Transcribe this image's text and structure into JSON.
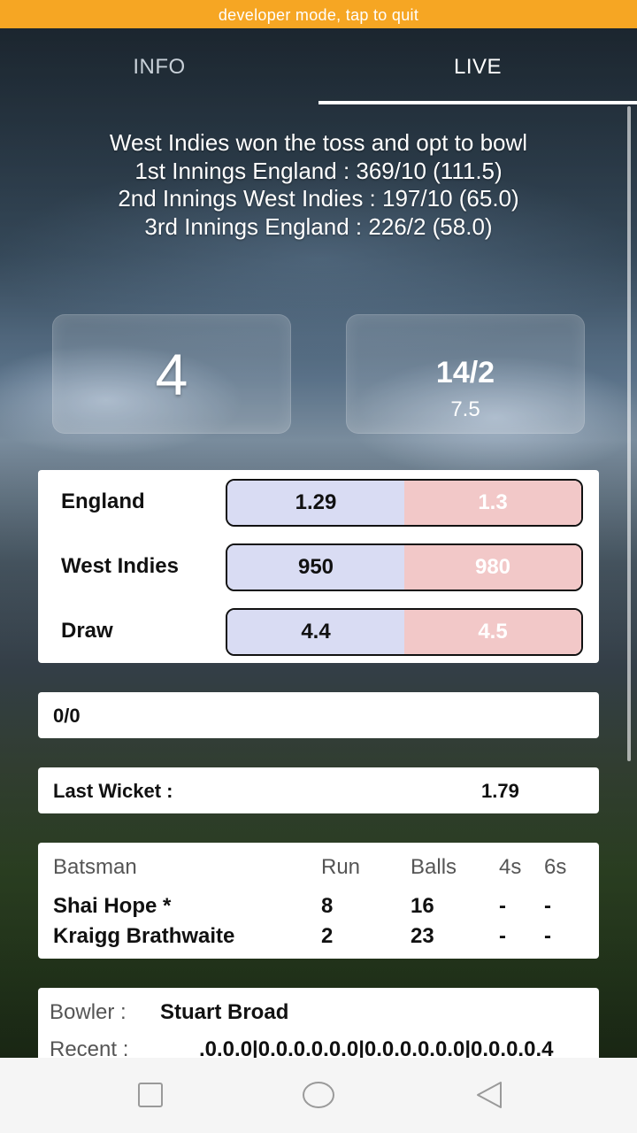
{
  "dev_banner": "developer mode, tap to quit",
  "tabs": {
    "info": "INFO",
    "live": "LIVE"
  },
  "summary": {
    "toss": "West Indies won the toss and opt to bowl",
    "innings": [
      "1st Innings England : 369/10 (111.5)",
      "2nd Innings West Indies : 197/10 (65.0)",
      "3rd Innings England : 226/2 (58.0)"
    ]
  },
  "scoreboard": {
    "last_ball": "4",
    "score": "14/2",
    "overs": "7.5"
  },
  "odds": [
    {
      "team": "England",
      "back": "1.29",
      "lay": "1.3"
    },
    {
      "team": "West Indies",
      "back": "950",
      "lay": "980"
    },
    {
      "team": "Draw",
      "back": "4.4",
      "lay": "4.5"
    }
  ],
  "status": "0/0",
  "last_wicket": {
    "label": "Last Wicket :",
    "value": "1.79"
  },
  "batting": {
    "headers": {
      "name": "Batsman",
      "run": "Run",
      "balls": "Balls",
      "fours": "4s",
      "sixes": "6s"
    },
    "rows": [
      {
        "name": "Shai Hope *",
        "run": "8",
        "balls": "16",
        "fours": "-",
        "sixes": "-"
      },
      {
        "name": "Kraigg Brathwaite",
        "run": "2",
        "balls": "23",
        "fours": "-",
        "sixes": "-"
      }
    ]
  },
  "bowling": {
    "bowler_label": "Bowler :",
    "bowler": "Stuart Broad",
    "recent_label": "Recent :",
    "recent": ".0.0.0|0.0.0.0.0.0|0.0.0.0.0.0|0.0.0.0.4"
  },
  "colors": {
    "dev_banner": "#f6a623",
    "back_odds": "#d9dcf3",
    "lay_odds": "#f2c8c8"
  },
  "nav_icons": [
    "recent-apps-icon",
    "home-icon",
    "back-icon"
  ]
}
